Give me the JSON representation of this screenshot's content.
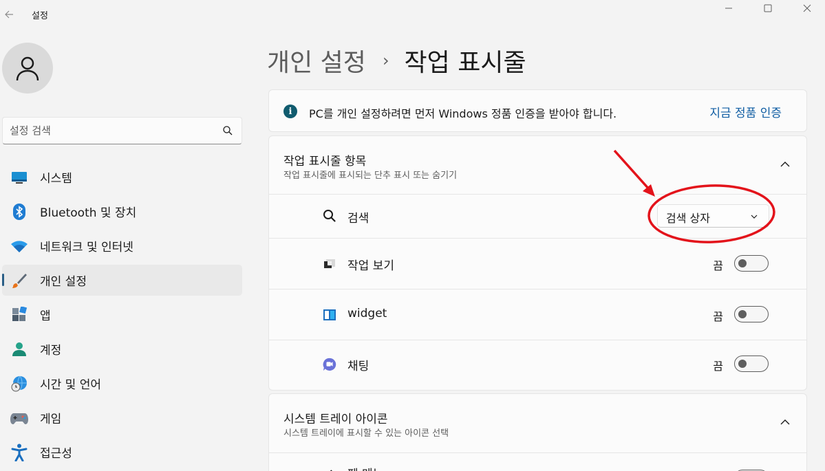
{
  "window": {
    "title": "설정",
    "back_icon": "back-arrow-icon",
    "controls": [
      "minimize",
      "maximize",
      "close"
    ]
  },
  "sidebar": {
    "search": {
      "placeholder": "설정 검색"
    },
    "items": [
      {
        "label": "시스템",
        "icon": "monitor-icon",
        "active": false
      },
      {
        "label": "Bluetooth 및 장치",
        "icon": "bluetooth-icon",
        "active": false
      },
      {
        "label": "네트워크 및 인터넷",
        "icon": "wifi-icon",
        "active": false
      },
      {
        "label": "개인 설정",
        "icon": "paintbrush-icon",
        "active": true
      },
      {
        "label": "앱",
        "icon": "apps-icon",
        "active": false
      },
      {
        "label": "계정",
        "icon": "person-icon",
        "active": false
      },
      {
        "label": "시간 및 언어",
        "icon": "globe-clock-icon",
        "active": false
      },
      {
        "label": "게임",
        "icon": "gamepad-icon",
        "active": false
      },
      {
        "label": "접근성",
        "icon": "accessibility-icon",
        "active": false
      }
    ]
  },
  "breadcrumb": {
    "parent": "개인 설정",
    "separator": "›",
    "current": "작업 표시줄"
  },
  "notice": {
    "text": "PC를 개인 설정하려면 먼저 Windows 정품 인증을 받아야 합니다.",
    "link": "지금 정품 인증"
  },
  "taskbar_items": {
    "title": "작업 표시줄 항목",
    "subtitle": "작업 표시줄에 표시되는 단추 표시 또는 숨기기",
    "expanded": true,
    "rows": [
      {
        "label": "검색",
        "icon": "search-icon",
        "control": "dropdown",
        "value": "검색 상자"
      },
      {
        "label": "작업 보기",
        "icon": "task-view-icon",
        "control": "toggle",
        "state_text": "끔",
        "on": false
      },
      {
        "label": "widget",
        "icon": "widgets-icon",
        "control": "toggle",
        "state_text": "끔",
        "on": false
      },
      {
        "label": "채팅",
        "icon": "chat-icon",
        "control": "toggle",
        "state_text": "끔",
        "on": false
      }
    ]
  },
  "system_tray": {
    "title": "시스템 트레이 아이콘",
    "subtitle": "시스템 트레이에 표시할 수 있는 아이콘 선택",
    "expanded": true,
    "partial_row_label": "펜 메뉴"
  },
  "annotation": {
    "color": "#e3131b"
  }
}
